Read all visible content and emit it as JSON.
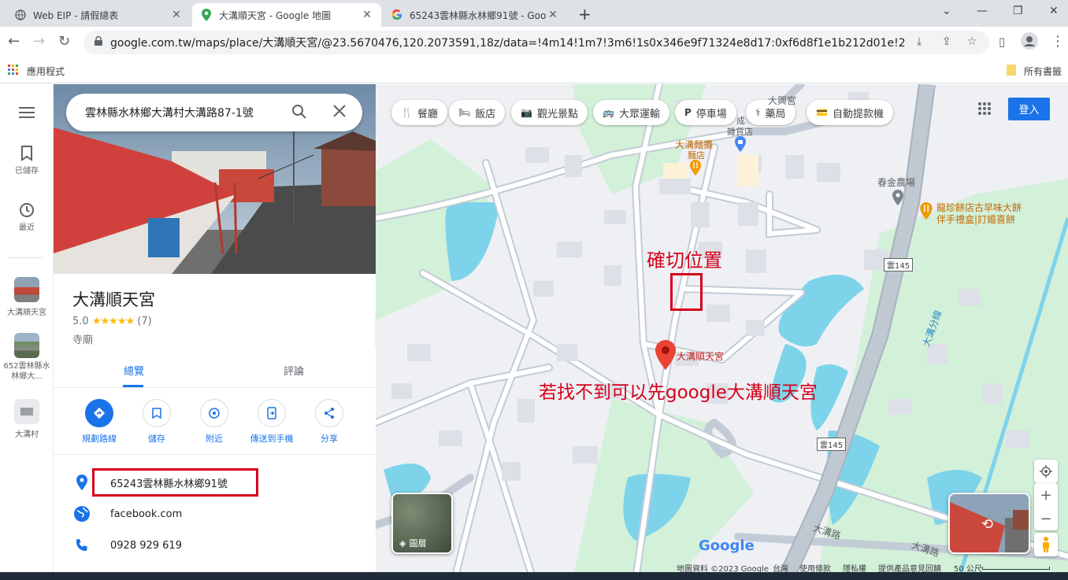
{
  "browser": {
    "tabs": [
      {
        "title": "Web EIP - 請假總表"
      },
      {
        "title": "大溝順天宮 - Google 地圖"
      },
      {
        "title": "65243雲林縣水林鄉91號 - Goog"
      }
    ],
    "url": "google.com.tw/maps/place/大溝順天宮/@23.5670476,120.2073591,18z/data=!4m14!1m7!3m6!1s0x346e9f71324e8d17:0xf6d8f1e1b212d01e!2zNjUy6Zu...",
    "bookmarks": {
      "apps": "應用程式",
      "all": "所有書籤"
    }
  },
  "rail": {
    "saved": "已儲存",
    "recent": "最近",
    "history": [
      {
        "label": "大溝順天宮"
      },
      {
        "label": "652雲林縣水林鄉大..."
      },
      {
        "label": "大溝村"
      }
    ]
  },
  "panel": {
    "search_value": "雲林縣水林鄉大溝村大溝路87-1號",
    "title": "大溝順天宮",
    "rating_value": "5.0",
    "stars": "★★★★★",
    "review_count": "(7)",
    "category": "寺廟",
    "tabs": {
      "overview": "總覽",
      "reviews": "評論"
    },
    "actions": {
      "directions": "規劃路線",
      "save": "儲存",
      "nearby": "附近",
      "send": "傳送到手機",
      "share": "分享"
    },
    "address": "65243雲林縣水林鄉91號",
    "website": "facebook.com",
    "phone": "0928 929 619"
  },
  "map": {
    "chips": {
      "restaurant": "餐廳",
      "hotel": "飯店",
      "attraction": "觀光景點",
      "transit": "大眾運輸",
      "parking": "停車場",
      "pharmacy": "藥局",
      "atm": "自動提款機"
    },
    "signin": "登入",
    "labels": {
      "temple_top": "大興宮",
      "noodle_shop": "大溝麵攤",
      "noodle_type": "麵店",
      "cheng_shop": "成",
      "cheng_type": "雜貨店",
      "farm": "春金農場",
      "bakery_line1": "龍珍餅店古早味大餅",
      "bakery_line2": "伴手禮盒|訂婚喜餅",
      "route1": "雲145",
      "route2": "雲145",
      "pin_label": "大溝順天宮",
      "canal": "大溝分線",
      "road1": "大溝路",
      "road2": "大溝路",
      "google": "Google",
      "layers": "圖層"
    },
    "annotations": {
      "exact": "確切位置",
      "hint": "若找不到可以先google大溝順天宮"
    },
    "footer": {
      "data": "地圖資料 ©2023 Google",
      "region": "台灣",
      "terms": "使用條款",
      "privacy": "隱私權",
      "feedback": "提供產品意見回饋",
      "scale": "50 公尺"
    }
  },
  "colors": {
    "accent": "#1a73e8",
    "annotation": "#d6001c",
    "water": "#7dd3ea",
    "green": "#d3f0d9",
    "road": "#aab4bf"
  }
}
